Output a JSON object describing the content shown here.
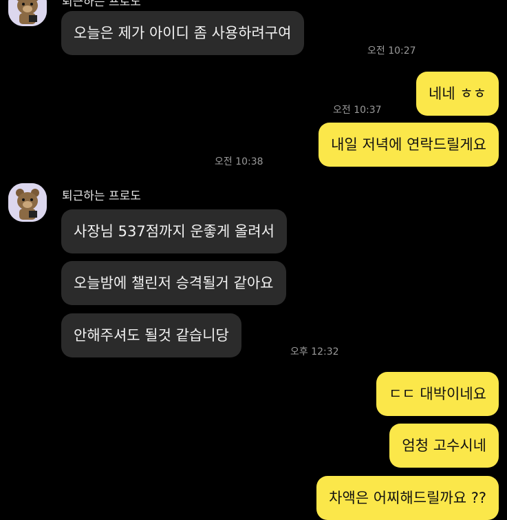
{
  "colors": {
    "background": "#000000",
    "incoming_bubble": "#2b2b2b",
    "outgoing_bubble": "#fbe74a",
    "avatar_bg": "#dcd7ee"
  },
  "messages": {
    "m1": {
      "text": "오늘은 제가 아이디 좀 사용하려구여",
      "time": "오전 10:27"
    },
    "m2": {
      "text": "네네 ㅎㅎ",
      "time": "오전 10:37"
    },
    "m3": {
      "text": "내일 저녁에 연락드릴게요",
      "time": "오전 10:38"
    },
    "sender": {
      "name": "퇴근하는 프로도",
      "avatar_icon": "bear-avatar-icon"
    },
    "m4": {
      "text": "사장님 537점까지 운좋게 올려서"
    },
    "m5": {
      "text": "오늘밤에 챌린저 승격될거 같아요"
    },
    "m6": {
      "text": "안해주셔도 될것 같습니당",
      "time": "오후 12:32"
    },
    "m7": {
      "text": "ㄷㄷ 대박이네요"
    },
    "m8": {
      "text": "엄청 고수시네"
    },
    "m9": {
      "text": "차액은 어찌해드릴까요 ??"
    }
  }
}
